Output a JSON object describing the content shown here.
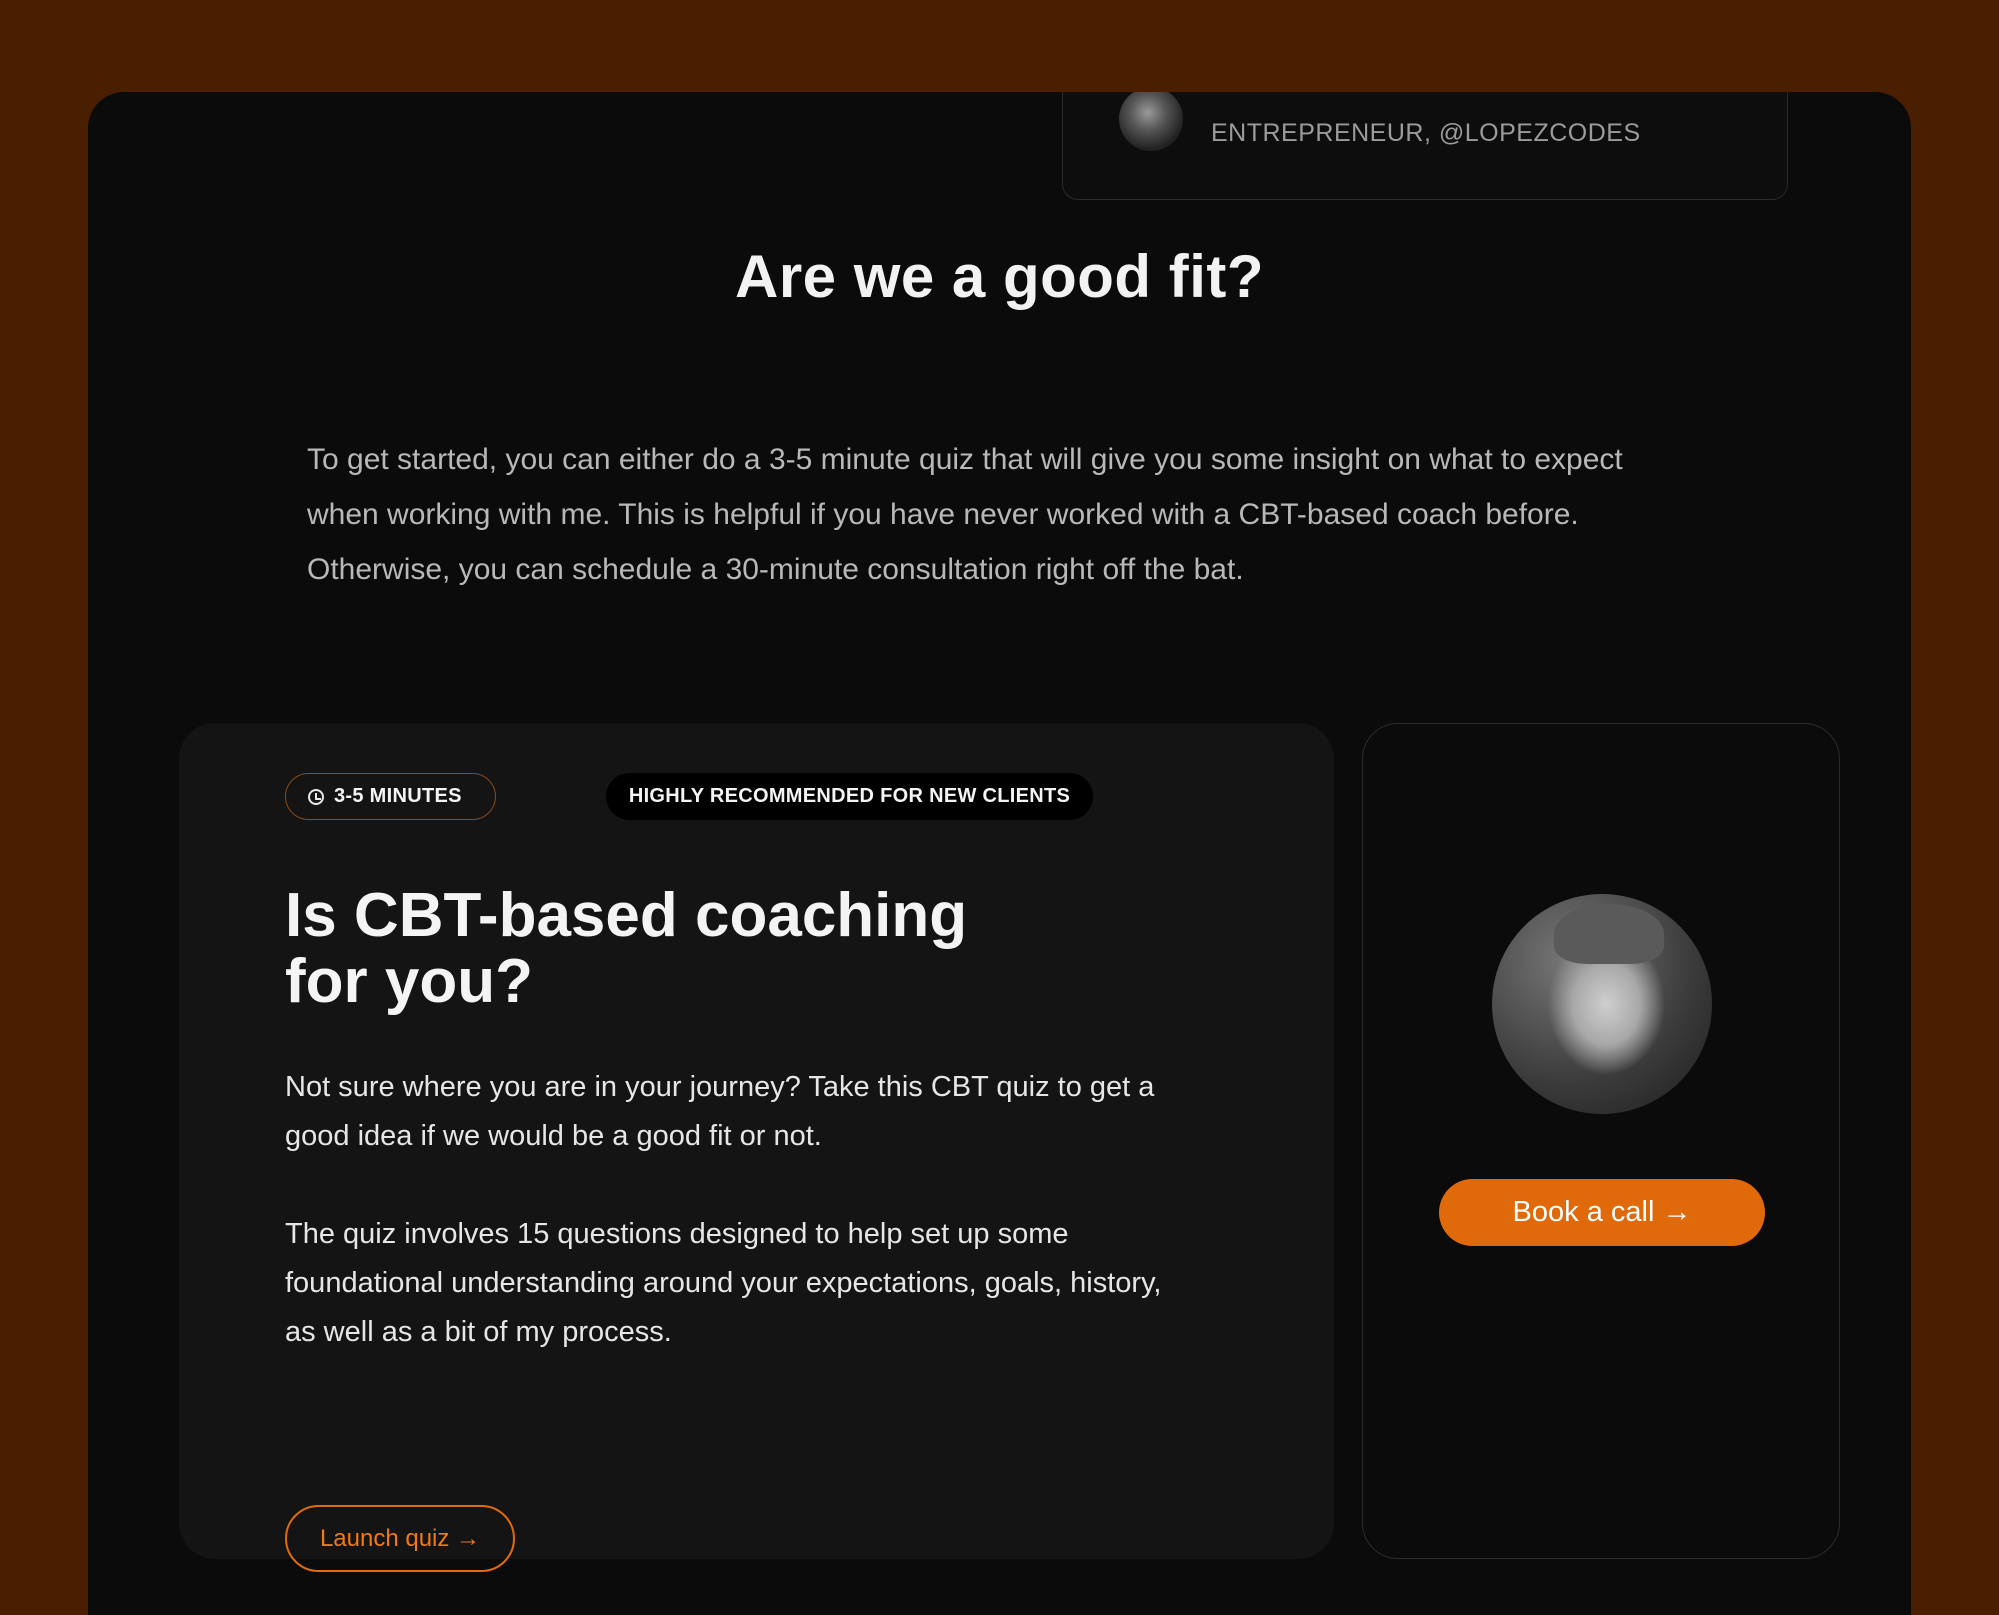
{
  "testimonial": {
    "role": "ENTREPRENEUR, @LOPEZCODES"
  },
  "section": {
    "title": "Are we a good fit?",
    "intro": "To get started, you can either do a 3-5 minute quiz that will give you some insight on what to expect when working with me. This is helpful if you have never worked with a CBT-based coach before. Otherwise, you can schedule a 30-minute consultation right off the bat."
  },
  "quiz": {
    "time_badge": "3-5 MINUTES",
    "recommended_badge": "HIGHLY RECOMMENDED FOR NEW CLIENTS",
    "title_line1": "Is CBT-based coaching",
    "title_line2": "for you?",
    "paragraph1": "Not sure where you are in your journey? Take this CBT quiz to get a good idea if we would be a good fit or not.",
    "paragraph2": "The quiz involves 15 questions designed to help set up some foundational understanding around your expectations, goals, history, as well as a bit of my process.",
    "launch_label": "Launch quiz →"
  },
  "call": {
    "book_label": "Book a call →"
  },
  "colors": {
    "frame_bg": "#4a1f00",
    "page_bg": "#0b0b0b",
    "card_bg": "#141414",
    "accent": "#e0690a"
  },
  "icons": {
    "clock": "clock-icon"
  }
}
